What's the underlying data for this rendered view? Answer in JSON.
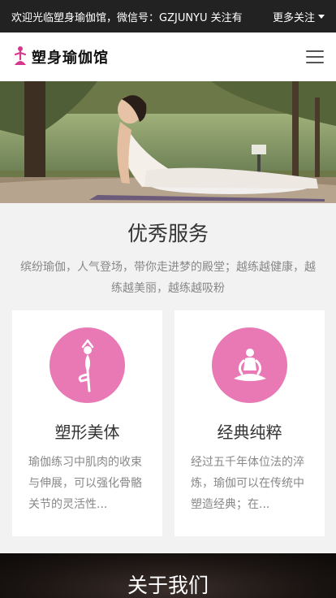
{
  "topbar": {
    "welcome": "欢迎光临塑身瑜伽馆，微信号：GZJUNYU 关注有",
    "more": "更多关注"
  },
  "header": {
    "logo_text": "塑身瑜伽馆",
    "logo_icon": "yoga-figure-icon",
    "menu_icon": "hamburger-menu-icon"
  },
  "services": {
    "title": "优秀服务",
    "description": "缤纷瑜伽，人气登场，带你走进梦的殿堂；越练越健康，越练越美丽，越练越吸粉",
    "cards": [
      {
        "icon": "yoga-standing-icon",
        "title": "塑形美体",
        "text": "瑜伽练习中肌肉的收束与伸展，可以强化骨骼关节的灵活性..."
      },
      {
        "icon": "yoga-meditation-icon",
        "title": "经典纯粹",
        "text": "经过五千年体位法的淬炼，瑜伽可以在传统中塑造经典；在..."
      }
    ]
  },
  "about": {
    "title": "关于我们"
  },
  "colors": {
    "accent": "#e879b5",
    "topbar": "#222222"
  }
}
